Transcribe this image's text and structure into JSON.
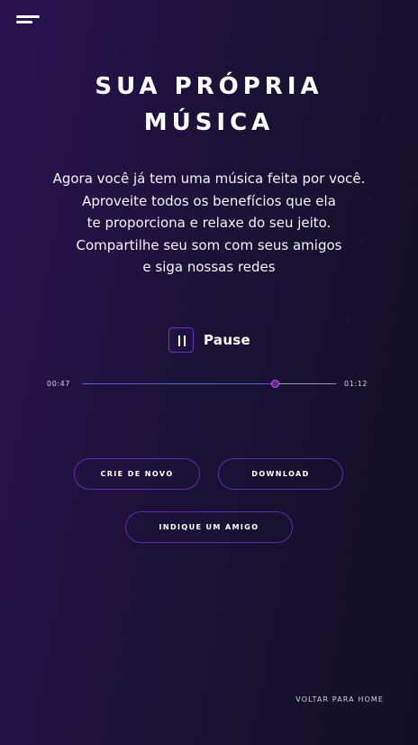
{
  "header": {
    "menu_icon": "hamburger-menu-icon"
  },
  "hero": {
    "title_lines": [
      "SUA PRÓPRIA",
      "MÚSICA"
    ],
    "description_lines": [
      "Agora você já tem uma música feita por você.",
      "Aproveite todos os benefícios que ela",
      "te proporciona e relaxe do seu jeito.",
      "Compartilhe seu som com seus amigos",
      "e siga nossas redes"
    ]
  },
  "player": {
    "toggle_label": "Pause",
    "toggle_icon": "pause-icon",
    "current_time": "00:47",
    "total_time": "01:12",
    "progress": 0.76
  },
  "actions": {
    "create_again_label": "CRIE DE NOVO",
    "download_label": "DOWNLOAD",
    "invite_label": "INDIQUE UM AMIGO"
  },
  "footer": {
    "home_link_label": "VOLTAR PARA HOME"
  },
  "colors": {
    "background_start": "#2a1350",
    "background_end": "#120f24",
    "accent_border": "#5a2ab8",
    "progress_fill": "#4f5fd8",
    "thumb": "#6b1f9e"
  }
}
